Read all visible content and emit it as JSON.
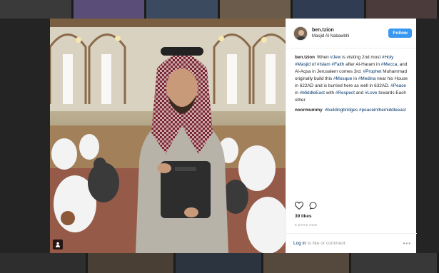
{
  "post": {
    "username": "ben.tzion",
    "location": "Masjid Al Nabawbhi",
    "follow_label": "Follow",
    "caption": {
      "user": "ben.tzion",
      "segments": [
        {
          "text": "When "
        },
        {
          "text": "#Jew",
          "tag": true
        },
        {
          "text": " is visiting 2nd most "
        },
        {
          "text": "#Holy",
          "tag": true
        },
        {
          "text": " "
        },
        {
          "text": "#Masjid",
          "tag": true
        },
        {
          "text": " of "
        },
        {
          "text": "#Islam",
          "tag": true
        },
        {
          "text": " "
        },
        {
          "text": "#Faith",
          "tag": true
        },
        {
          "text": " after Al-Haram in "
        },
        {
          "text": "#Mecca",
          "tag": true
        },
        {
          "text": ", and Al-Aqsa in Jerusalem comes 3rd. "
        },
        {
          "text": "#Prophet",
          "tag": true
        },
        {
          "text": " Muhammad originally build this "
        },
        {
          "text": "#Mosque",
          "tag": true
        },
        {
          "text": " in "
        },
        {
          "text": "#Medina",
          "tag": true
        },
        {
          "text": " near his House in 622AD and is burried here as well in 632AD. "
        },
        {
          "text": "#Peace",
          "tag": true
        },
        {
          "text": " in "
        },
        {
          "text": "#MiddleEast",
          "tag": true
        },
        {
          "text": " with "
        },
        {
          "text": "#Respect",
          "tag": true
        },
        {
          "text": " and "
        },
        {
          "text": "#Love",
          "tag": true
        },
        {
          "text": " towards Each other."
        }
      ]
    },
    "comment": {
      "user": "noormummy",
      "segments": [
        {
          "text": "#buildingbridges",
          "tag": true
        },
        {
          "text": " "
        },
        {
          "text": "#peaceinthemiddleeast",
          "tag": true
        }
      ]
    },
    "likes": "39 likes",
    "time_ago": "5 DAYS AGO",
    "footer": {
      "login_link": "Log in",
      "rest": " to like or comment.",
      "more": "•••"
    }
  },
  "icons": {
    "like": "heart-icon",
    "comment": "comment-icon",
    "tag": "person-tag-icon",
    "more": "more-options-icon"
  },
  "colors": {
    "follow_button": "#3897f0",
    "hashtag": "#003569",
    "muted": "#999999",
    "text": "#262626"
  }
}
